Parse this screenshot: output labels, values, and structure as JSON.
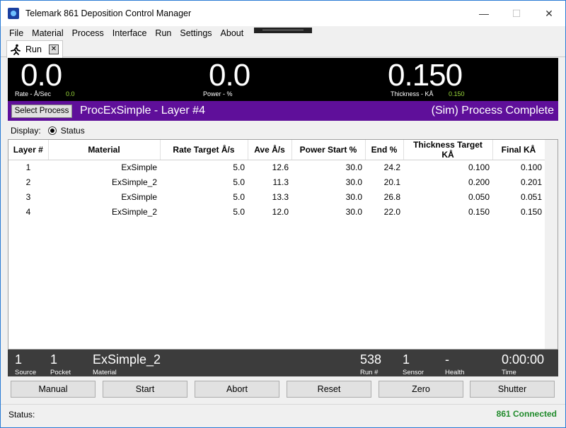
{
  "window": {
    "title": "Telemark 861 Deposition Control Manager"
  },
  "menu": [
    "File",
    "Material",
    "Process",
    "Interface",
    "Run",
    "Settings",
    "About"
  ],
  "tab": {
    "label": "Run"
  },
  "readout": {
    "rate_value": "0.0",
    "rate_label": "Rate - Å/Sec",
    "rate_small": "0.0",
    "power_value": "0.0",
    "power_label": "Power - %",
    "thickness_value": "0.150",
    "thickness_label": "Thickness  - KÅ",
    "thickness_small": "0.150"
  },
  "process": {
    "select_label": "Select Process",
    "name": "ProcExSimple - Layer #4",
    "status": "(Sim) Process Complete"
  },
  "display": {
    "label": "Display:",
    "option": "Status"
  },
  "table": {
    "headers": [
      "Layer #",
      "Material",
      "Rate Target Å/s",
      "Ave Å/s",
      "Power Start %",
      "End %",
      "Thickness Target KÅ",
      "Final KÅ"
    ],
    "rows": [
      [
        "1",
        "ExSimple",
        "5.0",
        "12.6",
        "30.0",
        "24.2",
        "0.100",
        "0.100"
      ],
      [
        "2",
        "ExSimple_2",
        "5.0",
        "11.3",
        "30.0",
        "20.1",
        "0.200",
        "0.201"
      ],
      [
        "3",
        "ExSimple",
        "5.0",
        "13.3",
        "30.0",
        "26.8",
        "0.050",
        "0.051"
      ],
      [
        "4",
        "ExSimple_2",
        "5.0",
        "12.0",
        "30.0",
        "22.0",
        "0.150",
        "0.150"
      ]
    ]
  },
  "bottom": {
    "source_value": "1",
    "source_label": "Source",
    "pocket_value": "1",
    "pocket_label": "Pocket",
    "material_value": "ExSimple_2",
    "material_label": "Material",
    "run_value": "538",
    "run_label": "Run #",
    "sensor_value": "1",
    "sensor_label": "Sensor",
    "health_value": "-",
    "health_label": "Health",
    "time_value": "0:00:00",
    "time_label": "Time"
  },
  "buttons": [
    "Manual",
    "Start",
    "Abort",
    "Reset",
    "Zero",
    "Shutter"
  ],
  "status": {
    "label": "Status:",
    "connection": "861 Connected"
  }
}
